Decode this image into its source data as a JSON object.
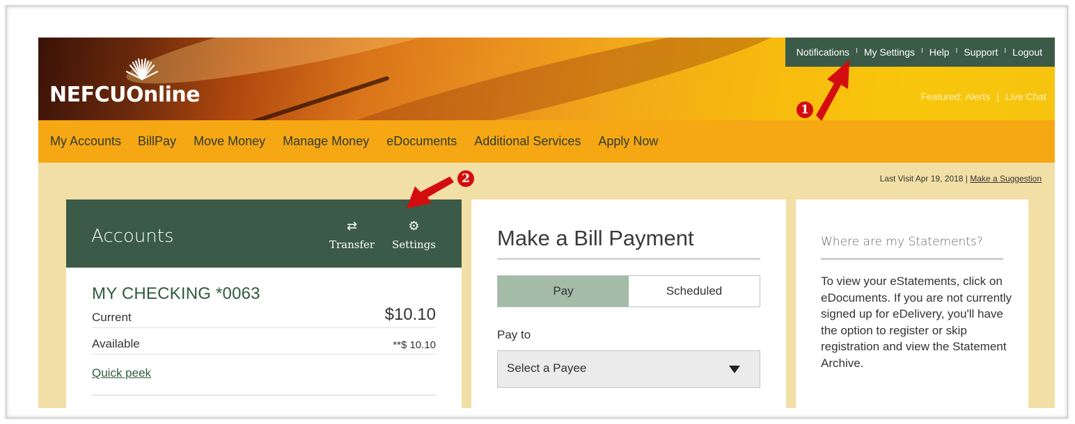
{
  "header": {
    "logo_text": "NEFCUOnline",
    "top_links": [
      "Notifications",
      "My Settings",
      "Help",
      "Support",
      "Logout"
    ],
    "featured_label": "Featured:",
    "featured_links": [
      "Alerts",
      "Live Chat"
    ],
    "featured_sep": "|"
  },
  "main_nav": [
    "My Accounts",
    "BillPay",
    "Move Money",
    "Manage Money",
    "eDocuments",
    "Additional Services",
    "Apply Now"
  ],
  "last_visit": {
    "text": "Last Visit Apr 19, 2018 |",
    "suggestion_link": "Make a Suggestion"
  },
  "accounts": {
    "title": "Accounts",
    "transfer_label": "Transfer",
    "settings_label": "Settings",
    "account_name": "MY CHECKING *0063",
    "current_label": "Current",
    "current_value": "$10.10",
    "available_label": "Available",
    "available_value": "**$ 10.10",
    "quick_peek": "Quick peek"
  },
  "bill_payment": {
    "title": "Make a Bill Payment",
    "tab_pay": "Pay",
    "tab_scheduled": "Scheduled",
    "pay_to_label": "Pay to",
    "payee_select": "Select a Payee"
  },
  "statements": {
    "title": "Where are my Statements?",
    "body": "To view your eStatements, click on eDocuments. If you are not currently signed up for eDelivery, you'll have the option to register or skip registration and view the Statement Archive."
  },
  "annotations": {
    "step1": "1",
    "step2": "2",
    "color": "#d30d0d"
  },
  "colors": {
    "dark_green": "#3b5a48",
    "nav_orange": "#f6a714",
    "content_bg": "#f2dfa6",
    "tab_active": "#a3bba7"
  }
}
